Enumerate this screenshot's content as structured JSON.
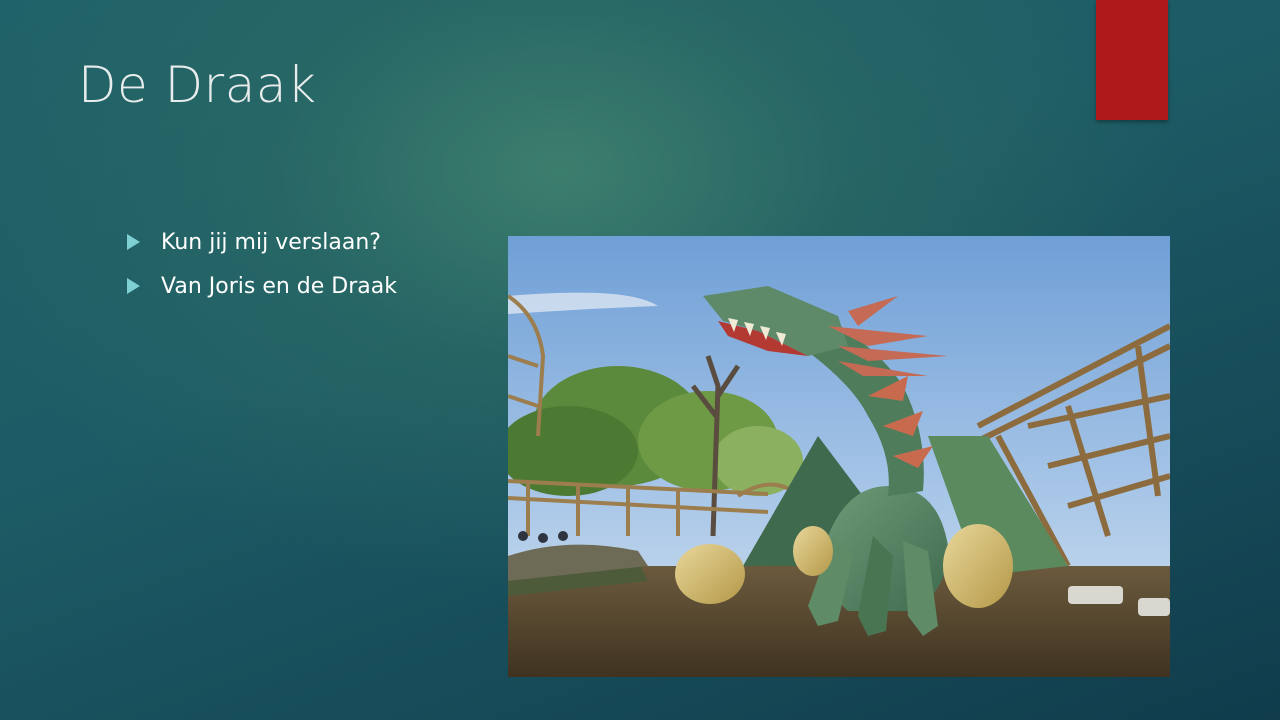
{
  "slide": {
    "title": "De Draak",
    "bullets": [
      {
        "text": "Kun jij mij verslaan?"
      },
      {
        "text": "Van Joris en de Draak"
      }
    ]
  },
  "theme": {
    "background": "#1d5c66",
    "accent_tab": "#b0191b",
    "bullet_arrow": "#7ed0d3",
    "title_color": "#e9ecec",
    "text_color": "#ffffff"
  },
  "photo": {
    "subject": "dragon statue in pond with wooden roller coaster",
    "icon": "dragon-photo"
  }
}
